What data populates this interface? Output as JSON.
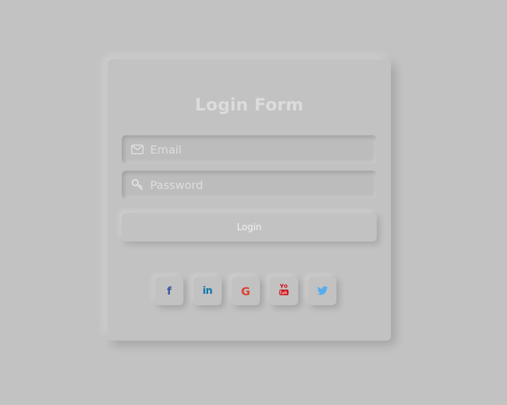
{
  "login": {
    "title": "Login Form",
    "email": {
      "placeholder": "Email",
      "value": "",
      "icon": "envelope-icon"
    },
    "password": {
      "placeholder": "Password",
      "value": "",
      "icon": "key-icon"
    },
    "submit_label": "Login"
  },
  "social": [
    {
      "name": "facebook",
      "icon": "facebook-icon",
      "glyph": "f",
      "color": "#3b5998"
    },
    {
      "name": "linkedin",
      "icon": "linkedin-icon",
      "glyph": "in",
      "color": "#0e76a8"
    },
    {
      "name": "google",
      "icon": "google-icon",
      "glyph": "G",
      "color": "#db4437"
    },
    {
      "name": "youtube",
      "icon": "youtube-icon",
      "color": "#cc181e"
    },
    {
      "name": "twitter",
      "icon": "twitter-icon",
      "color": "#55acee"
    }
  ],
  "colors": {
    "background": "#c2c2c2",
    "title": "#dcdcdc",
    "placeholder": "#dedede"
  }
}
